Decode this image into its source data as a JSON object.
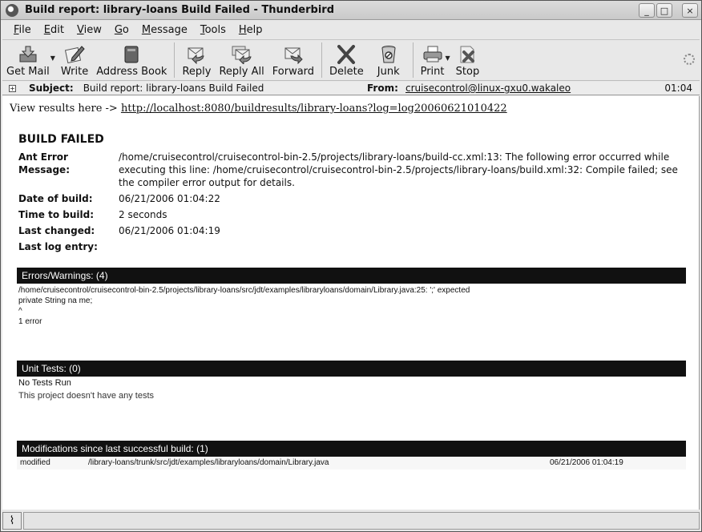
{
  "window": {
    "title": "Build report: library-loans Build Failed - Thunderbird",
    "controls": {
      "minimize": "_",
      "maximize": "□",
      "close": "×"
    }
  },
  "menu": [
    {
      "label": "File",
      "mnemonic": "F",
      "rest": "ile"
    },
    {
      "label": "Edit",
      "mnemonic": "E",
      "rest": "dit"
    },
    {
      "label": "View",
      "mnemonic": "V",
      "rest": "iew"
    },
    {
      "label": "Go",
      "mnemonic": "G",
      "rest": "o"
    },
    {
      "label": "Message",
      "mnemonic": "M",
      "rest": "essage"
    },
    {
      "label": "Tools",
      "mnemonic": "T",
      "rest": "ools"
    },
    {
      "label": "Help",
      "mnemonic": "H",
      "rest": "elp"
    }
  ],
  "toolbar": {
    "get_mail": "Get Mail",
    "write": "Write",
    "address_book": "Address Book",
    "reply": "Reply",
    "reply_all": "Reply All",
    "forward": "Forward",
    "delete": "Delete",
    "junk": "Junk",
    "print": "Print",
    "stop": "Stop"
  },
  "header": {
    "subject_label": "Subject:",
    "subject": "Build report: library-loans Build Failed",
    "from_label": "From:",
    "from": "cruisecontrol@linux-gxu0.wakaleo",
    "time": "01:04"
  },
  "body": {
    "view_results_prefix": "View results here -> ",
    "view_results_link": "http://localhost:8080/buildresults/library-loans?log=log20060621010422",
    "status_heading": "BUILD FAILED",
    "info": [
      {
        "label": "Ant Error Message:",
        "value": "/home/cruisecontrol/cruisecontrol-bin-2.5/projects/library-loans/build-cc.xml:13: The following error occurred while executing this line: /home/cruisecontrol/cruisecontrol-bin-2.5/projects/library-loans/build.xml:32: Compile failed; see the compiler error output for details."
      },
      {
        "label": "Date of build:",
        "value": "06/21/2006 01:04:22"
      },
      {
        "label": "Time to build:",
        "value": "2 seconds"
      },
      {
        "label": "Last changed:",
        "value": "06/21/2006 01:04:19"
      },
      {
        "label": "Last log entry:",
        "value": ""
      }
    ],
    "errors": {
      "title": "Errors/Warnings: (4)",
      "lines": [
        "/home/cruisecontrol/cruisecontrol-bin-2.5/projects/library-loans/src/jdt/examples/libraryloans/domain/Library.java:25: ';' expected",
        "private String na me;",
        "^",
        "1 error"
      ]
    },
    "unit_tests": {
      "title": "Unit Tests: (0)",
      "status": "No Tests Run",
      "note": "This project doesn't have any tests"
    },
    "modifications": {
      "title": "Modifications since last successful build:  (1)",
      "rows": [
        {
          "type": "modified",
          "file": "/library-loans/trunk/src/jdt/examples/libraryloans/domain/Library.java",
          "date": "06/21/2006 01:04:19"
        }
      ]
    }
  }
}
